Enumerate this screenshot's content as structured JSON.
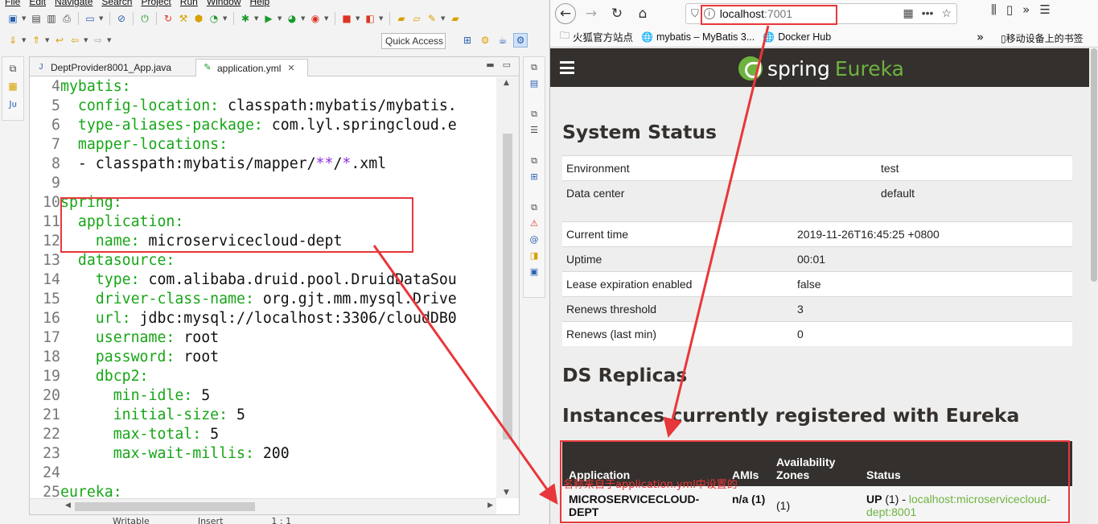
{
  "eclipse": {
    "menu": [
      "File",
      "Edit",
      "Navigate",
      "Search",
      "Project",
      "Run",
      "Window",
      "Help"
    ],
    "quick_access": "Quick Access",
    "tabs": [
      {
        "label": "DeptProvider8001_App.java",
        "active": false
      },
      {
        "label": "application.yml",
        "active": true
      }
    ],
    "code_lines": [
      {
        "n": "4",
        "segs": [
          {
            "t": "mybatis:",
            "c": "k"
          }
        ]
      },
      {
        "n": "5",
        "segs": [
          {
            "t": "  config-location: ",
            "c": "k"
          },
          {
            "t": "classpath:mybatis/mybatis.",
            "c": "v"
          }
        ]
      },
      {
        "n": "6",
        "segs": [
          {
            "t": "  type-aliases-package: ",
            "c": "k"
          },
          {
            "t": "com.lyl.springcloud.e",
            "c": "v"
          }
        ]
      },
      {
        "n": "7",
        "segs": [
          {
            "t": "  mapper-locations:",
            "c": "k"
          }
        ]
      },
      {
        "n": "8",
        "segs": [
          {
            "t": "  - classpath:mybatis/mapper/",
            "c": "v"
          },
          {
            "t": "**",
            "c": "p"
          },
          {
            "t": "/",
            "c": "v"
          },
          {
            "t": "*",
            "c": "p"
          },
          {
            "t": ".xml",
            "c": "v"
          }
        ]
      },
      {
        "n": "9",
        "segs": []
      },
      {
        "n": "10",
        "segs": [
          {
            "t": "spring:",
            "c": "k"
          }
        ]
      },
      {
        "n": "11",
        "segs": [
          {
            "t": "  application:",
            "c": "k"
          }
        ]
      },
      {
        "n": "12",
        "segs": [
          {
            "t": "    name: ",
            "c": "k"
          },
          {
            "t": "microservicecloud-dept",
            "c": "v"
          }
        ]
      },
      {
        "n": "13",
        "segs": [
          {
            "t": "  datasource:",
            "c": "k"
          }
        ]
      },
      {
        "n": "14",
        "segs": [
          {
            "t": "    type: ",
            "c": "k"
          },
          {
            "t": "com.alibaba.druid.pool.DruidDataSou",
            "c": "v"
          }
        ]
      },
      {
        "n": "15",
        "segs": [
          {
            "t": "    driver-class-name: ",
            "c": "k"
          },
          {
            "t": "org.gjt.mm.mysql.Drive",
            "c": "v"
          }
        ]
      },
      {
        "n": "16",
        "segs": [
          {
            "t": "    url: ",
            "c": "k"
          },
          {
            "t": "jdbc:mysql://localhost:3306/cloudDB0",
            "c": "v"
          }
        ]
      },
      {
        "n": "17",
        "segs": [
          {
            "t": "    username: ",
            "c": "k"
          },
          {
            "t": "root",
            "c": "v"
          }
        ]
      },
      {
        "n": "18",
        "segs": [
          {
            "t": "    password: ",
            "c": "k"
          },
          {
            "t": "root",
            "c": "v"
          }
        ]
      },
      {
        "n": "19",
        "segs": [
          {
            "t": "    dbcp2:",
            "c": "k"
          }
        ]
      },
      {
        "n": "20",
        "segs": [
          {
            "t": "      min-idle: ",
            "c": "k"
          },
          {
            "t": "5",
            "c": "v"
          }
        ]
      },
      {
        "n": "21",
        "segs": [
          {
            "t": "      initial-size: ",
            "c": "k"
          },
          {
            "t": "5",
            "c": "v"
          }
        ]
      },
      {
        "n": "22",
        "segs": [
          {
            "t": "      max-total: ",
            "c": "k"
          },
          {
            "t": "5",
            "c": "v"
          }
        ]
      },
      {
        "n": "23",
        "segs": [
          {
            "t": "      max-wait-millis: ",
            "c": "k"
          },
          {
            "t": "200",
            "c": "v"
          }
        ]
      },
      {
        "n": "24",
        "segs": []
      },
      {
        "n": "25",
        "segs": [
          {
            "t": "eureka:",
            "c": "k"
          }
        ]
      }
    ],
    "status": [
      "Writable",
      "Insert",
      "1 : 1"
    ]
  },
  "firefox": {
    "url_host": "localhost",
    "url_port": ":7001",
    "bookmarks": [
      "火狐官方站点",
      "mybatis – MyBatis 3...",
      "Docker Hub"
    ],
    "mobile_bookmarks": "移动设备上的书签"
  },
  "eureka": {
    "brand_spring": "spring",
    "brand_eureka": "Eureka",
    "system_status_title": "System Status",
    "env_rows": [
      {
        "key": "Environment",
        "value": "test"
      },
      {
        "key": "Data center",
        "value": "default"
      }
    ],
    "status_rows": [
      {
        "key": "Current time",
        "value": "2019-11-26T16:45:25 +0800"
      },
      {
        "key": "Uptime",
        "value": "00:01"
      },
      {
        "key": "Lease expiration enabled",
        "value": "false"
      },
      {
        "key": "Renews threshold",
        "value": "3"
      },
      {
        "key": "Renews (last min)",
        "value": "0"
      }
    ],
    "ds_replicas_title": "DS Replicas",
    "instances_title": "Instances currently registered with Eureka",
    "instance_headers": [
      "Application",
      "AMIs",
      "Availability\nZones",
      "Status"
    ],
    "instance_row": {
      "application": "MICROSERVICECLOUD-DEPT",
      "amis": "n/a (1)",
      "zones": "(1)",
      "status_up": "UP",
      "status_count": " (1) - ",
      "status_link": "localhost:microservicecloud-dept:8001"
    }
  },
  "annotation": {
    "note": "名称来自于application.yml中设置的",
    "color": "#e8373a"
  }
}
